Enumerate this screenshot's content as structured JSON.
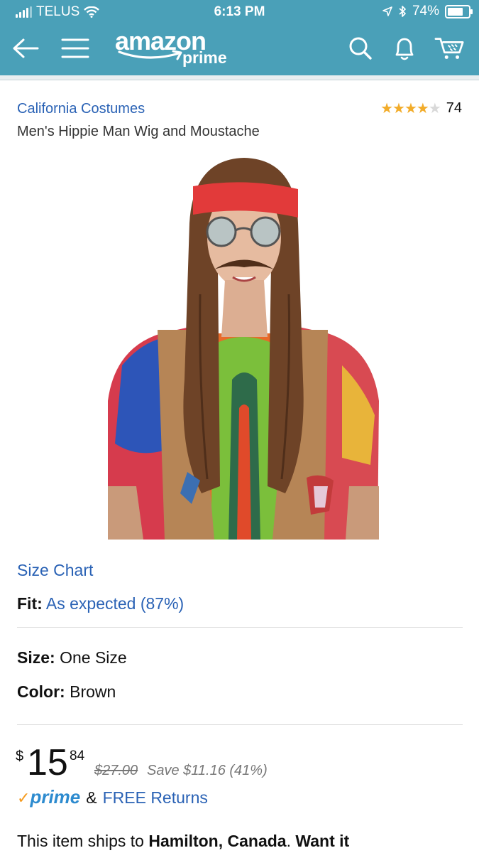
{
  "status_bar": {
    "carrier": "TELUS",
    "time": "6:13 PM",
    "battery": "74%",
    "battery_level": 0.74,
    "icons": [
      "signal-icon",
      "wifi-icon",
      "location-icon",
      "bluetooth-icon",
      "battery-icon"
    ]
  },
  "header": {
    "logo_main": "amazon",
    "logo_sub": "prime",
    "icons": [
      "back-arrow-icon",
      "menu-icon",
      "search-icon",
      "bell-icon",
      "cart-icon"
    ]
  },
  "product": {
    "brand": "California Costumes",
    "rating_stars": 4,
    "rating_max": 5,
    "rating_count": "74",
    "title": "Men's Hippie Man Wig and Moustache",
    "size_chart_label": "Size Chart",
    "fit_label": "Fit:",
    "fit_value": "As expected (87%)",
    "size_label": "Size:",
    "size_value": "One Size",
    "color_label": "Color:",
    "color_value": "Brown"
  },
  "price": {
    "currency": "$",
    "whole": "15",
    "fraction": "84",
    "list_price": "$27.00",
    "savings": "Save $11.16 (41%)"
  },
  "shipping": {
    "prime_check": "✓",
    "prime_word": "prime",
    "ampersand": "&",
    "returns_label": "FREE Returns",
    "ships_prefix": "This item ships to ",
    "ships_location": "Hamilton, Canada",
    "ships_mid": ". ",
    "ships_cta": "Want it"
  },
  "colors": {
    "header_bg": "#4aa0b8",
    "link": "#2a62b5",
    "star": "#f2ac2a",
    "prime_blue": "#2d8bcf",
    "prime_check": "#f59a1d"
  }
}
